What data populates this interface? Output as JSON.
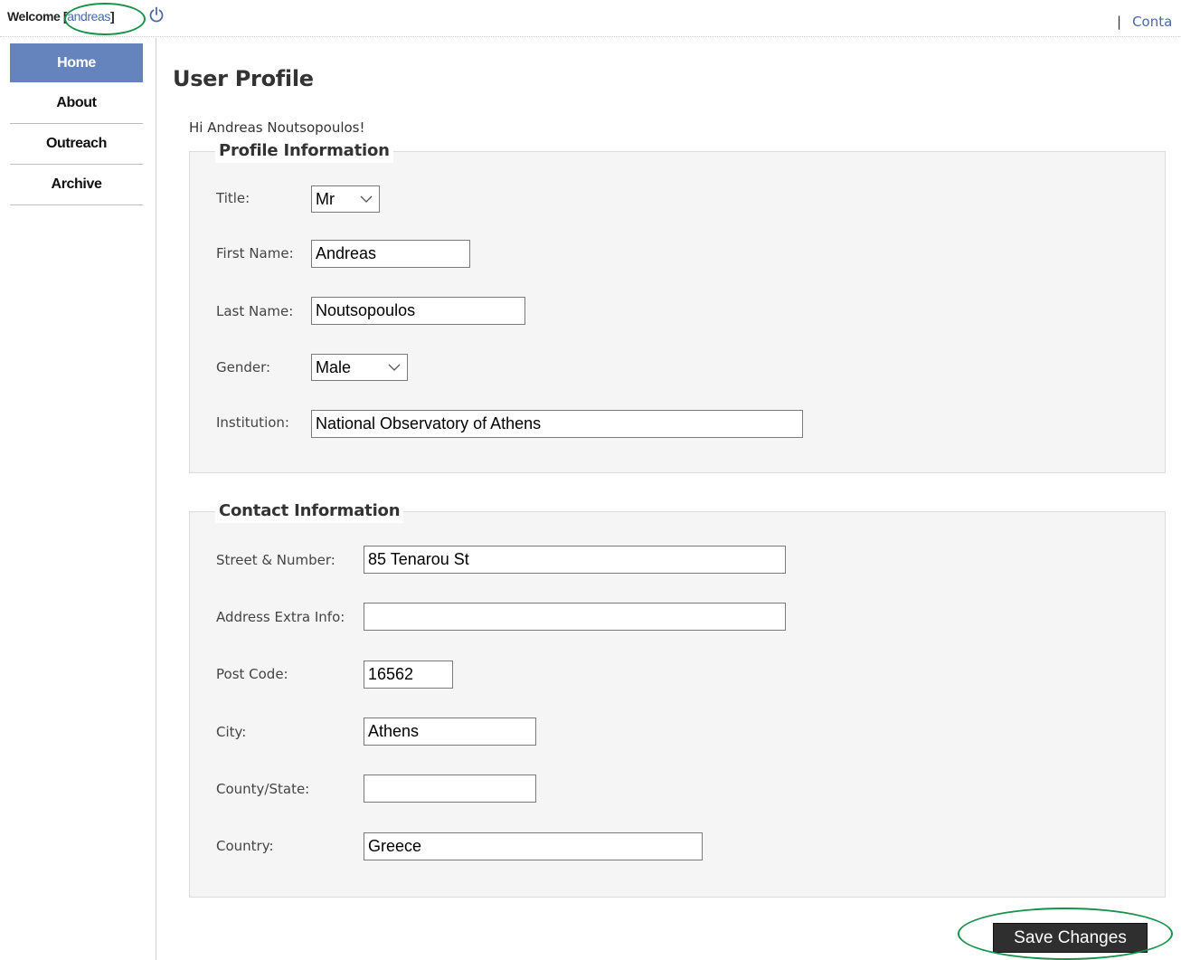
{
  "header": {
    "welcome_label": "Welcome",
    "username": "andreas",
    "bracket_open": "[",
    "bracket_close": "]",
    "separator": "|",
    "contact_link": "Conta",
    "logout_icon": "power-icon"
  },
  "sidebar": {
    "items": [
      {
        "label": "Home",
        "active": true
      },
      {
        "label": "About",
        "active": false
      },
      {
        "label": "Outreach",
        "active": false
      },
      {
        "label": "Archive",
        "active": false
      }
    ]
  },
  "page": {
    "title": "User Profile",
    "greeting": "Hi Andreas Noutsopoulos!"
  },
  "profile": {
    "legend": "Profile Information",
    "title": {
      "label": "Title:",
      "value": "Mr"
    },
    "first_name": {
      "label": "First Name:",
      "value": "Andreas"
    },
    "last_name": {
      "label": "Last Name:",
      "value": "Noutsopoulos"
    },
    "gender": {
      "label": "Gender:",
      "value": "Male"
    },
    "institution": {
      "label": "Institution:",
      "value": "National Observatory of Athens"
    }
  },
  "contact": {
    "legend": "Contact Information",
    "street": {
      "label": "Street & Number:",
      "value": "85 Tenarou St"
    },
    "address_extra": {
      "label": "Address Extra Info:",
      "value": ""
    },
    "post_code": {
      "label": "Post Code:",
      "value": "16562"
    },
    "city": {
      "label": "City:",
      "value": "Athens"
    },
    "county_state": {
      "label": "County/State:",
      "value": ""
    },
    "country": {
      "label": "Country:",
      "value": "Greece"
    }
  },
  "actions": {
    "save_label": "Save Changes"
  },
  "colors": {
    "nav_active": "#6583bd",
    "link": "#4a6aa8",
    "highlight_ring": "#15934a",
    "panel_bg": "#f5f5f5",
    "button_bg": "#2f2f2f"
  }
}
